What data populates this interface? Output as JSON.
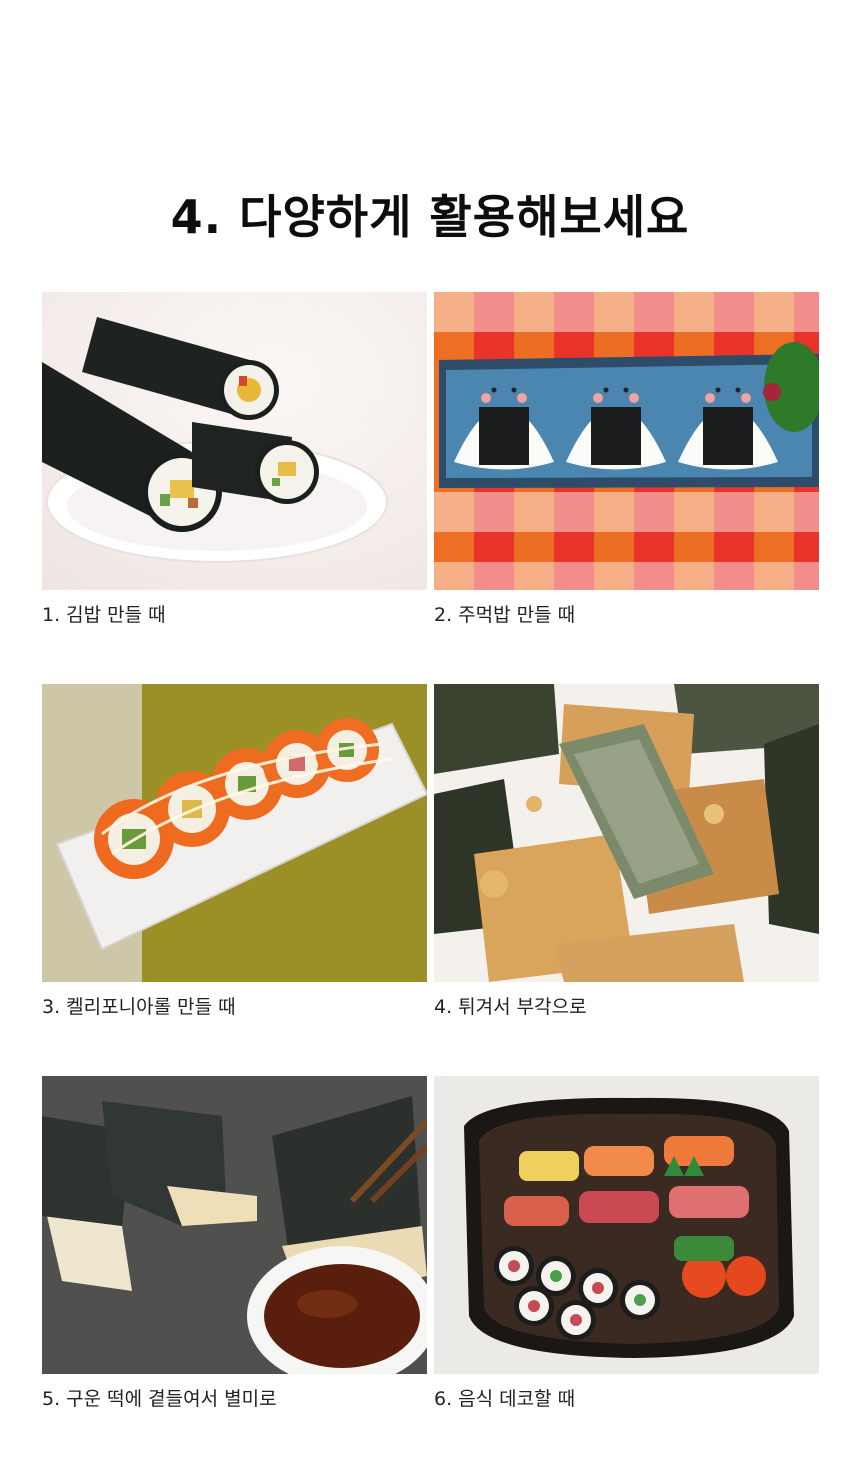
{
  "heading": "4. 다양하게 활용해보세요",
  "items": [
    {
      "caption": "1. 김밥 만들 때",
      "image": "kimbap-rolls-photo"
    },
    {
      "caption": "2. 주먹밥 만들 때",
      "image": "onigiri-photo"
    },
    {
      "caption": "3. 켈리포니아롤 만들 때",
      "image": "california-roll-photo"
    },
    {
      "caption": "4. 튀겨서 부각으로",
      "image": "fried-seaweed-photo"
    },
    {
      "caption": "5. 구운 떡에 곁들여서 별미로",
      "image": "grilled-ricecake-photo"
    },
    {
      "caption": "6. 음식 데코할 때",
      "image": "sushi-platter-photo"
    }
  ]
}
